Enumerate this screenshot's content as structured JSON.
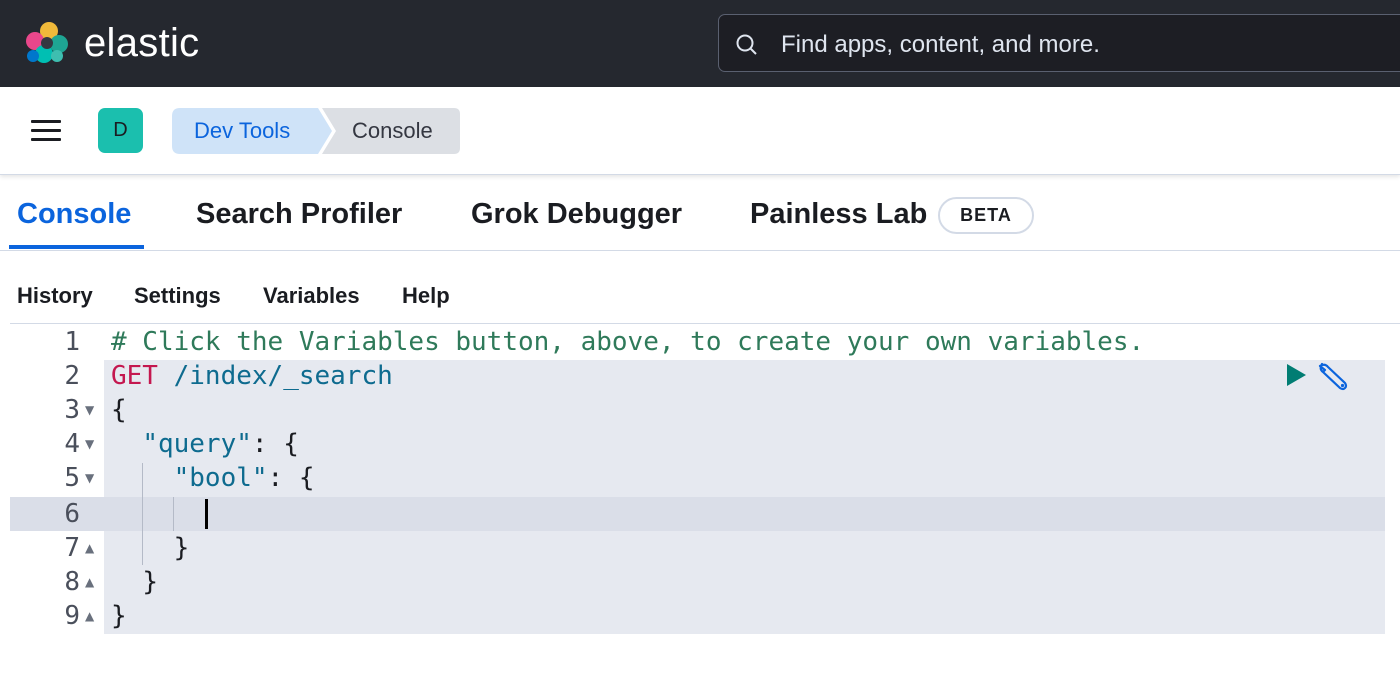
{
  "header": {
    "brand": "elastic",
    "search_placeholder": "Find apps, content, and more."
  },
  "breadcrumbs": {
    "avatar_initial": "D",
    "items": [
      "Dev Tools",
      "Console"
    ]
  },
  "tabs": [
    {
      "label": "Console",
      "active": true
    },
    {
      "label": "Search Profiler",
      "active": false
    },
    {
      "label": "Grok Debugger",
      "active": false
    },
    {
      "label": "Painless Lab",
      "active": false,
      "badge": "BETA"
    }
  ],
  "toolbar": {
    "history": "History",
    "settings": "Settings",
    "variables": "Variables",
    "help": "Help"
  },
  "editor": {
    "line_numbers": [
      "1",
      "2",
      "3",
      "4",
      "5",
      "6",
      "7",
      "8",
      "9"
    ],
    "comment": "# Click the Variables button, above, to create your own variables.",
    "method": "GET",
    "path": "/index/_search",
    "open_brace": "{",
    "query_key": "\"query\"",
    "bool_key": "\"bool\"",
    "colon_brace": ": {",
    "close_brace": "}",
    "active_line": 6
  },
  "colors": {
    "header_bg": "#25282f",
    "accent": "#0b64dd",
    "avatar": "#1bbfae",
    "run_icon": "#017d73"
  },
  "icons": {
    "logo": "elastic-logo",
    "search": "search-icon",
    "menu": "hamburger-menu-icon",
    "run": "play-icon",
    "wrench": "wrench-icon",
    "fold_open": "fold-down-icon",
    "fold_close": "fold-up-icon"
  }
}
